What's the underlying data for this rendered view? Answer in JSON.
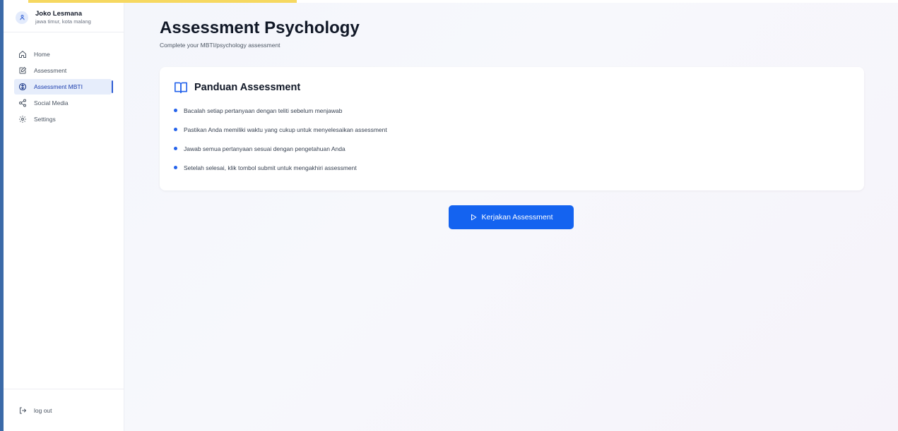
{
  "user": {
    "name": "Joko Lesmana",
    "location": "jawa timur, kota malang"
  },
  "sidebar": {
    "items": [
      {
        "label": "Home",
        "icon": "home-icon"
      },
      {
        "label": "Assessment",
        "icon": "edit-icon"
      },
      {
        "label": "Assessment MBTI",
        "icon": "compass-icon",
        "active": true
      },
      {
        "label": "Social Media",
        "icon": "share-icon"
      },
      {
        "label": "Settings",
        "icon": "gear-icon"
      }
    ],
    "logout_label": "log out"
  },
  "main": {
    "title": "Assessment Psychology",
    "subtitle": "Complete your MBTI/psychology assessment",
    "guide": {
      "title": "Panduan Assessment",
      "icon": "book-icon",
      "items": [
        "Bacalah setiap pertanyaan dengan teliti sebelum menjawab",
        "Pastikan Anda memiliki waktu yang cukup untuk menyelesaikan assessment",
        "Jawab semua pertanyaan sesuai dengan pengetahuan Anda",
        "Setelah selesai, klik tombol submit untuk mengakhiri assessment"
      ]
    },
    "start_button": "Kerjakan Assessment"
  },
  "colors": {
    "accent": "#1463f0",
    "active_bg": "#e6edfb",
    "bullet": "#2563eb"
  }
}
